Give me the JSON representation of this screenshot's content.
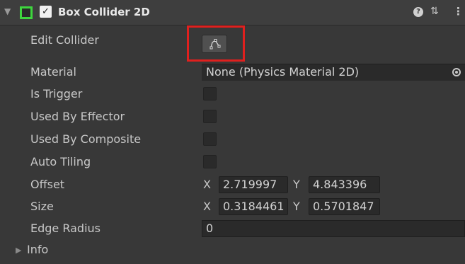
{
  "header": {
    "title": "Box Collider 2D",
    "enabled": true,
    "icons": [
      "foldout-arrow-icon",
      "box-collider-2d-icon",
      "help-icon",
      "presets-icon",
      "menu-icon"
    ],
    "accent_color": "#3ed53e"
  },
  "fields": {
    "edit_collider_label": "Edit Collider",
    "material_label": "Material",
    "material_value": "None (Physics Material 2D)",
    "is_trigger_label": "Is Trigger",
    "used_by_effector_label": "Used By Effector",
    "used_by_composite_label": "Used By Composite",
    "auto_tiling_label": "Auto Tiling",
    "offset_label": "Offset",
    "offset_x": "2.719997",
    "offset_y": "4.843396",
    "size_label": "Size",
    "size_x": "0.3184461",
    "size_y": "0.5701847",
    "edge_radius_label": "Edge Radius",
    "edge_radius_value": "0",
    "info_label": "Info",
    "axis_x": "X",
    "axis_y": "Y"
  },
  "checkboxes": {
    "is_trigger": false,
    "used_by_effector": false,
    "used_by_composite": false,
    "auto_tiling": false
  },
  "highlight_color": "#e0201e"
}
